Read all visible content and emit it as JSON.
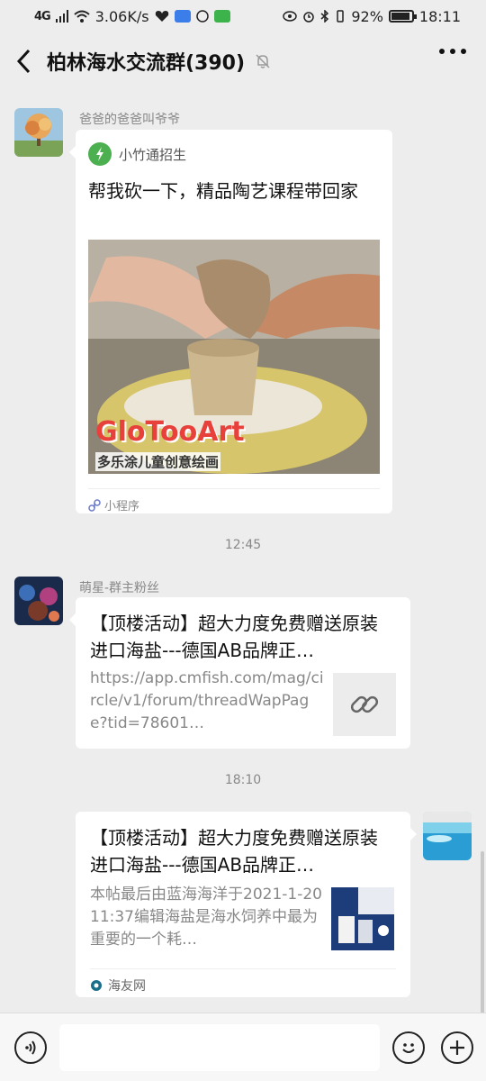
{
  "status_bar": {
    "signal": "4G",
    "speed": "3.06K/s",
    "battery": "92%",
    "time": "18:11"
  },
  "header": {
    "title": "柏林海水交流群(390)"
  },
  "messages": [
    {
      "sender": "爸爸的爸爸叫爷爷",
      "mini_program": {
        "app_name": "小竹通招生",
        "title": "帮我砍一下，精品陶艺课程带回家",
        "image_brand": "GloTooArt",
        "image_caption": "多乐涂儿童创意绘画",
        "footer_label": "小程序"
      }
    },
    {
      "timestamp": "12:45"
    },
    {
      "sender": "萌星-群主粉丝",
      "link": {
        "title": "【顶楼活动】超大力度免费赠送原装进口海盐---德国AB品牌正…",
        "desc": "https://app.cmfish.com/mag/circle/v1/forum/threadWapPage?tid=78601…"
      }
    },
    {
      "timestamp": "18:10"
    },
    {
      "self": true,
      "link": {
        "title": "【顶楼活动】超大力度免费赠送原装进口海盐---德国AB品牌正…",
        "desc": "本帖最后由蓝海海洋于2021-1-2011:37编辑海盐是海水饲养中最为重要的一个耗…",
        "source": "海友网"
      }
    }
  ],
  "colors": {
    "background": "#ededed",
    "bubble": "#ffffff",
    "accent": "#4caf50"
  }
}
